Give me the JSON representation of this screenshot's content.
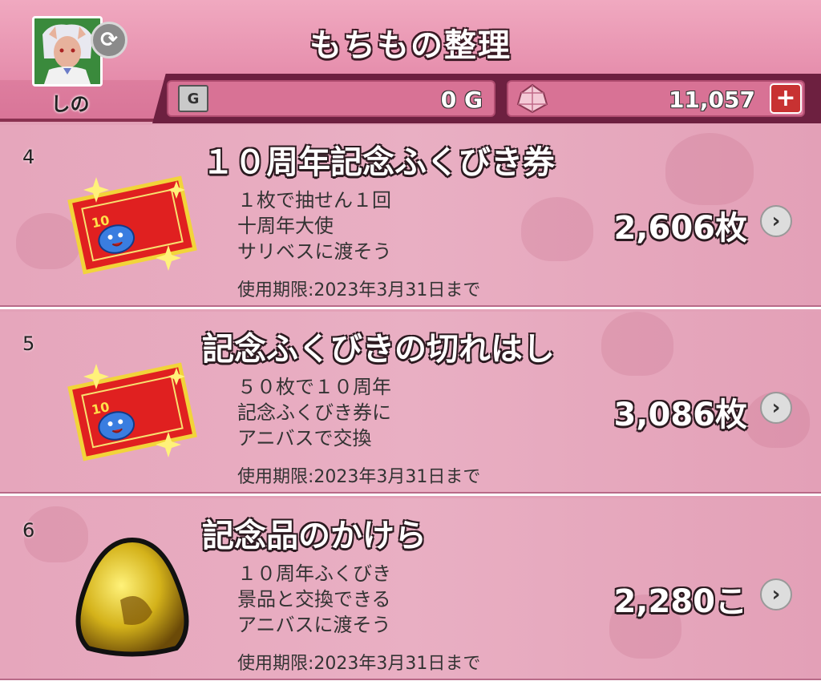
{
  "header": {
    "title": "もちもの整理",
    "player_name": "しの",
    "gold": "0 G",
    "gems": "11,057",
    "add_label": "+",
    "sync_glyph": "⟳",
    "gold_icon_glyph": "G"
  },
  "items": [
    {
      "index": "4",
      "name": "１０周年記念ふくびき券",
      "desc": [
        "１枚で抽せん１回",
        "十周年大使",
        "サリベスに渡そう"
      ],
      "expiry": "使用期限:2023年3月31日まで",
      "quantity": "2,606枚",
      "icon": "ticket-icon"
    },
    {
      "index": "5",
      "name": "記念ふくびきの切れはし",
      "desc": [
        "５０枚で１０周年",
        "記念ふくびき券に",
        "アニバスで交換"
      ],
      "expiry": "使用期限:2023年3月31日まで",
      "quantity": "3,086枚",
      "icon": "ticket-icon"
    },
    {
      "index": "6",
      "name": "記念品のかけら",
      "desc": [
        "１０周年ふくびき",
        "景品と交換できる",
        "アニバスに渡そう"
      ],
      "expiry": "使用期限:2023年3月31日まで",
      "quantity": "2,280こ",
      "icon": "gold-fragment-icon"
    }
  ],
  "colors": {
    "header_pink": "#e58cab",
    "row_pink": "#e9afc3",
    "strip_dark": "#6d2040",
    "add_red": "#c83232"
  }
}
